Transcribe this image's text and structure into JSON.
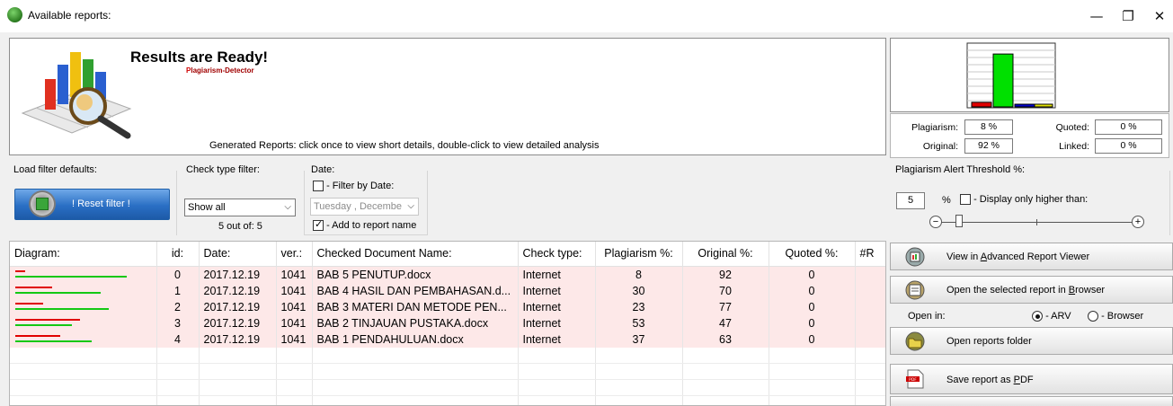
{
  "window": {
    "title": "Available reports:",
    "controls": {
      "minimize": "—",
      "restore": "❐",
      "close": "✕"
    }
  },
  "header": {
    "title": "Results are Ready!",
    "product_p": "P",
    "product_rest": "lagiarism-Detector",
    "generated_text": "Generated Reports: click once to view short details, double-click to view detailed analysis"
  },
  "stats": {
    "plagiarism_label": "Plagiarism:",
    "plagiarism_value": "8 %",
    "quoted_label": "Quoted:",
    "quoted_value": "0 %",
    "original_label": "Original:",
    "original_value": "92 %",
    "linked_label": "Linked:",
    "linked_value": "0 %",
    "mini_chart": {
      "plagiarism": 8,
      "original": 92,
      "quoted": 0,
      "linked": 0,
      "colors": {
        "plagiarism": "#e00000",
        "original": "#00e000",
        "quoted": "#0000cc",
        "linked": "#e0e000"
      }
    }
  },
  "filters": {
    "load_defaults_label": "Load filter defaults:",
    "reset_button": "! Reset filter !",
    "check_type_label": "Check type filter:",
    "check_type_value": "Show all",
    "count_text": "5 out of: 5",
    "date_label": "Date:",
    "filter_by_date": "- Filter by Date:",
    "filter_by_date_checked": false,
    "date_value": "Tuesday  , Decembe",
    "add_to_report_name": "- Add to report name",
    "add_to_report_name_checked": true
  },
  "threshold": {
    "label": "Plagiarism Alert Threshold %:",
    "value": "5",
    "unit": "%",
    "display_higher": "- Display only higher than:",
    "display_higher_checked": false,
    "minus": "−",
    "plus": "+"
  },
  "table": {
    "columns": [
      "Diagram:",
      "id:",
      "Date:",
      "ver.:",
      "Checked Document Name:",
      "Check type:",
      "Plagiarism %:",
      "Original %:",
      "Quoted %:",
      "#R"
    ],
    "rows": [
      {
        "id": "0",
        "date": "2017.12.19",
        "ver": "1041",
        "name": "BAB 5 PENUTUP.docx",
        "type": "Internet",
        "plag": "8",
        "orig": "92",
        "quoted": "0",
        "plag_num": 8,
        "orig_num": 92
      },
      {
        "id": "1",
        "date": "2017.12.19",
        "ver": "1041",
        "name": "BAB 4 HASIL DAN PEMBAHASAN.d...",
        "type": "Internet",
        "plag": "30",
        "orig": "70",
        "quoted": "0",
        "plag_num": 30,
        "orig_num": 70
      },
      {
        "id": "2",
        "date": "2017.12.19",
        "ver": "1041",
        "name": "BAB 3 MATERI DAN METODE PEN...",
        "type": "Internet",
        "plag": "23",
        "orig": "77",
        "quoted": "0",
        "plag_num": 23,
        "orig_num": 77
      },
      {
        "id": "3",
        "date": "2017.12.19",
        "ver": "1041",
        "name": "BAB 2 TINJAUAN PUSTAKA.docx",
        "type": "Internet",
        "plag": "53",
        "orig": "47",
        "quoted": "0",
        "plag_num": 53,
        "orig_num": 47
      },
      {
        "id": "4",
        "date": "2017.12.19",
        "ver": "1041",
        "name": "BAB 1 PENDAHULUAN.docx",
        "type": "Internet",
        "plag": "37",
        "orig": "63",
        "quoted": "0",
        "plag_num": 37,
        "orig_num": 63
      }
    ]
  },
  "actions": {
    "view_advanced_pre": "View in ",
    "view_advanced_u": "A",
    "view_advanced_post": "dvanced Report Viewer",
    "open_browser_pre": "Open the selected report in ",
    "open_browser_u": "B",
    "open_browser_post": "rowser",
    "open_in_label": "Open in:",
    "arv_label": "- ARV",
    "browser_label": "- Browser",
    "open_folder": "Open reports folder",
    "save_pdf_pre": "Save report as ",
    "save_pdf_u": "P",
    "save_pdf_post": "DF"
  }
}
